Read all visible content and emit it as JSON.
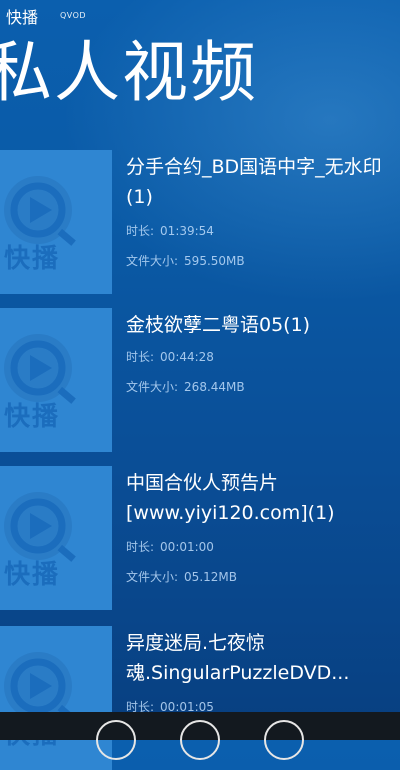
{
  "header": {
    "app_name": "快播",
    "app_sub": "QVOD"
  },
  "page": {
    "title": "私人视频"
  },
  "thumbnail": {
    "label": "快播",
    "logo_icon": "qvod-play-logo-icon"
  },
  "videos": [
    {
      "title": "分手合约_BD国语中字_无水印(1)",
      "duration_label": "时长:",
      "duration": "01:39:54",
      "size_label": "文件大小:",
      "size": "595.50MB"
    },
    {
      "title": "金枝欲孽二粤语05(1)",
      "duration_label": "时长:",
      "duration": "00:44:28",
      "size_label": "文件大小:",
      "size": "268.44MB"
    },
    {
      "title": "中国合伙人预告片[www.yiyi120.com](1)",
      "duration_label": "时长:",
      "duration": "00:01:00",
      "size_label": "文件大小:",
      "size": "05.12MB"
    },
    {
      "title": "异度迷局.七夜惊魂.SingularPuzzleDVD...",
      "duration_label": "时长:",
      "duration": "00:01:05",
      "size_label": "",
      "size": ""
    }
  ],
  "colors": {
    "accent": "#2f86d2",
    "background": "#0a5aa6",
    "appbar": "#13191f"
  }
}
